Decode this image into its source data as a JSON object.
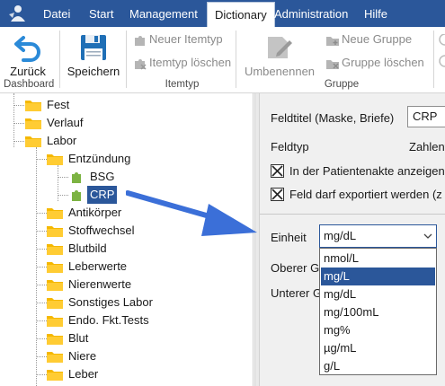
{
  "menu": {
    "items": [
      "Datei",
      "Start",
      "Management",
      "Dictionary",
      "Administration",
      "Hilfe"
    ],
    "active": "Dictionary"
  },
  "ribbon": {
    "back_label": "Zurück",
    "save_label": "Speichern",
    "new_itemtype_label": "Neuer Itemtyp",
    "delete_itemtype_label": "Itemtyp löschen",
    "rename_label": "Umbenennen",
    "new_group_label": "Neue Gruppe",
    "delete_group_label": "Gruppe löschen",
    "group_dashboard": "Dashboard",
    "group_itemtyp": "Itemtyp",
    "group_gruppe": "Gruppe"
  },
  "tree": {
    "fest": "Fest",
    "verlauf": "Verlauf",
    "labor": "Labor",
    "entzuendung": "Entzündung",
    "bsg": "BSG",
    "crp": "CRP",
    "antikoerper": "Antikörper",
    "stoffwechsel": "Stoffwechsel",
    "blutbild": "Blutbild",
    "leberwerte": "Leberwerte",
    "nierenwerte": "Nierenwerte",
    "sonstiges_labor": "Sonstiges Labor",
    "endo": "Endo. Fkt.Tests",
    "blut": "Blut",
    "niere": "Niere",
    "leber": "Leber"
  },
  "form": {
    "feldtitel_label": "Feldtitel (Maske, Briefe)",
    "feldtitel_value": "CRP",
    "feldtyp_label": "Feldtyp",
    "feldtyp_value": "Zahlenf",
    "check1_label": "In der Patientenakte anzeigen",
    "check2_label": "Feld darf exportiert werden (z",
    "einheit_label": "Einheit",
    "einheit_value": "mg/dL",
    "oberer_label": "Oberer G",
    "unterer_label": "Unterer G"
  },
  "dropdown": {
    "options": [
      "nmol/L",
      "mg/L",
      "mg/dL",
      "mg/100mL",
      "mg%",
      "µg/mL",
      "g/L"
    ],
    "selected_index": 1
  },
  "colors": {
    "accent": "#2b579a",
    "annotation_arrow": "#3b6fd8",
    "folder": "#f5b800",
    "leaf": "#7cb342"
  }
}
